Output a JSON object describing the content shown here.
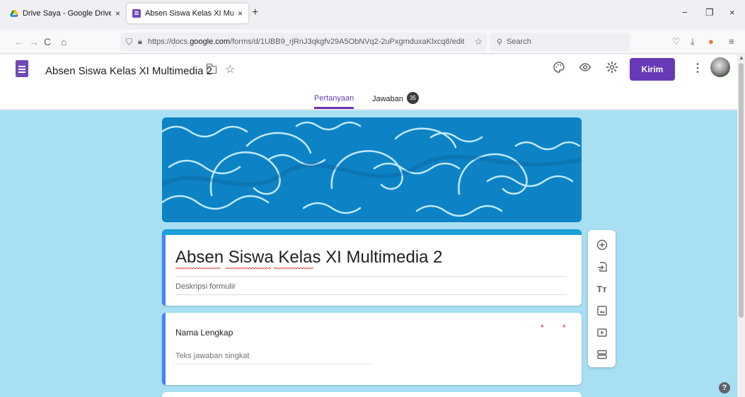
{
  "browser": {
    "tabs": [
      {
        "label": "Drive Saya - Google Drive",
        "close": "×"
      },
      {
        "label": "Absen Siswa Kelas XI Multimedi",
        "close": "×"
      }
    ],
    "new_tab": "+",
    "window_controls": {
      "minimize": "−",
      "restore": "❐",
      "close": "×"
    },
    "url_prefix": "https://docs.",
    "url_domain": "google.com",
    "url_suffix": "/forms/d/1UBB9_rjRnJ3qkgfv29A5ObNVq2-2uPxgmduxaKlxcq8/edit",
    "search_placeholder": "Search",
    "icons": [
      "back-icon",
      "forward-icon",
      "reload-icon",
      "home-icon",
      "shield-icon",
      "lock-icon",
      "star-icon",
      "pocket-icon",
      "download-icon",
      "extension-icon",
      "menu-icon"
    ]
  },
  "forms_header": {
    "doc_title": "Absen Siswa Kelas XI Multimedia 2",
    "send_label": "Kirim",
    "tabs": {
      "questions": "Pertanyaan",
      "responses": "Jawaban",
      "responses_count": "35"
    },
    "accent_color": "#673ab7"
  },
  "form": {
    "title": "Absen Siswa Kelas XI Multimedia 2",
    "description_placeholder": "Deskripsi formulir",
    "questions": [
      {
        "title": "Nama Lengkap",
        "answer_placeholder": "Teks jawaban singkat",
        "required_marks": [
          "*",
          "*"
        ]
      }
    ],
    "theme_color": "#1a9fd7",
    "background_color": "#a8dff2"
  },
  "side_toolbar": {
    "icons": [
      "add-question-icon",
      "import-questions-icon",
      "add-title-icon",
      "add-image-icon",
      "add-video-icon",
      "add-section-icon"
    ],
    "title_label": "Tт"
  },
  "help": "?"
}
